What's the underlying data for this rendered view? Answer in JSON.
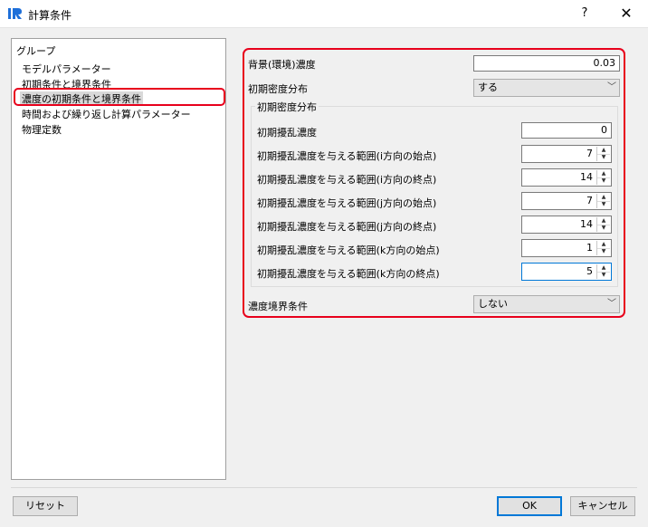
{
  "window": {
    "title": "計算条件",
    "help_label": "?",
    "close_label": "✕"
  },
  "group_tree": {
    "header": "グループ",
    "items": [
      {
        "label": "モデルパラメーター"
      },
      {
        "label": "初期条件と境界条件"
      },
      {
        "label": "濃度の初期条件と境界条件"
      },
      {
        "label": "時間および繰り返し計算パラメーター"
      },
      {
        "label": "物理定数"
      }
    ],
    "selected_index": 2
  },
  "form": {
    "background_concentration": {
      "label": "背景(環境)濃度",
      "value": "0.03"
    },
    "initial_density_dist": {
      "label": "初期密度分布",
      "value": "する"
    },
    "initial_density_group": {
      "title": "初期密度分布",
      "initial_disturbance": {
        "label": "初期擾乱濃度",
        "value": "0"
      },
      "ranges": [
        {
          "label": "初期擾乱濃度を与える範囲(i方向の始点)",
          "value": "7"
        },
        {
          "label": "初期擾乱濃度を与える範囲(i方向の終点)",
          "value": "14"
        },
        {
          "label": "初期擾乱濃度を与える範囲(j方向の始点)",
          "value": "7"
        },
        {
          "label": "初期擾乱濃度を与える範囲(j方向の終点)",
          "value": "14"
        },
        {
          "label": "初期擾乱濃度を与える範囲(k方向の始点)",
          "value": "1"
        },
        {
          "label": "初期擾乱濃度を与える範囲(k方向の終点)",
          "value": "5"
        }
      ]
    },
    "concentration_boundary": {
      "label": "濃度境界条件",
      "value": "しない"
    }
  },
  "buttons": {
    "reset": "リセット",
    "ok": "OK",
    "cancel": "キャンセル"
  },
  "icons": {
    "app": "iric-app-icon",
    "dropdown": "chevron-down-icon",
    "spin_up": "spin-up-icon",
    "spin_down": "spin-down-icon"
  },
  "colors": {
    "highlight": "#e8001c",
    "focus": "#0078d7",
    "selection": "#d9d9d9"
  }
}
